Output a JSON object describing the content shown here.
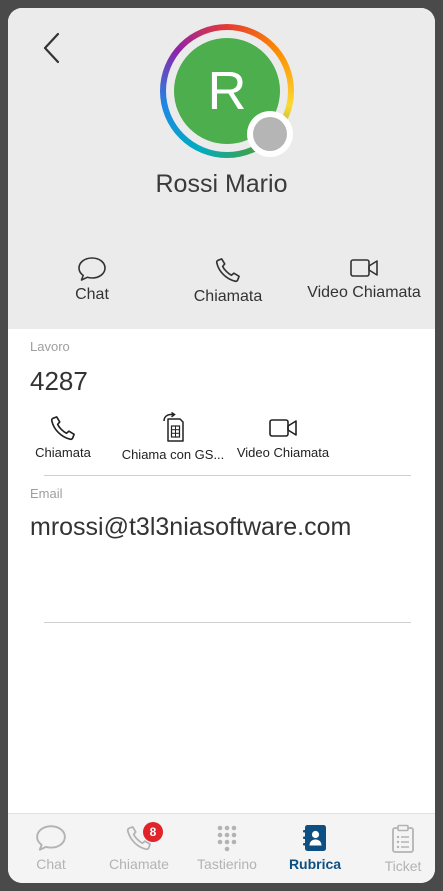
{
  "contact": {
    "initial": "R",
    "name": "Rossi Mario"
  },
  "header_actions": [
    {
      "label": "Chat",
      "icon": "chat-bubble-icon"
    },
    {
      "label": "Chiamata",
      "icon": "phone-icon"
    },
    {
      "label": "Video Chiamata",
      "icon": "video-camera-icon"
    }
  ],
  "work": {
    "label": "Lavoro",
    "number": "4287",
    "actions": [
      {
        "label": "Chiamata",
        "icon": "phone-icon"
      },
      {
        "label": "Chiama con GS...",
        "icon": "sim-call-icon"
      },
      {
        "label": "Video Chiamata",
        "icon": "video-camera-icon"
      }
    ]
  },
  "email": {
    "label": "Email",
    "value": "mrossi@t3l3niasoftware.com"
  },
  "bottom_nav": [
    {
      "label": "Chat",
      "icon": "chat-bubble-icon",
      "active": false
    },
    {
      "label": "Chiamate",
      "icon": "phone-icon",
      "active": false,
      "badge": "8"
    },
    {
      "label": "Tastierino",
      "icon": "dialpad-icon",
      "active": false
    },
    {
      "label": "Rubrica",
      "icon": "contacts-book-icon",
      "active": true
    },
    {
      "label": "Ticket",
      "icon": "clipboard-icon",
      "active": false
    }
  ],
  "colors": {
    "avatar_bg": "#4cae4c",
    "presence": "#b5b5b5",
    "active_tab": "#0d4f82",
    "badge": "#e0242a",
    "header_bg": "#ebebeb"
  }
}
